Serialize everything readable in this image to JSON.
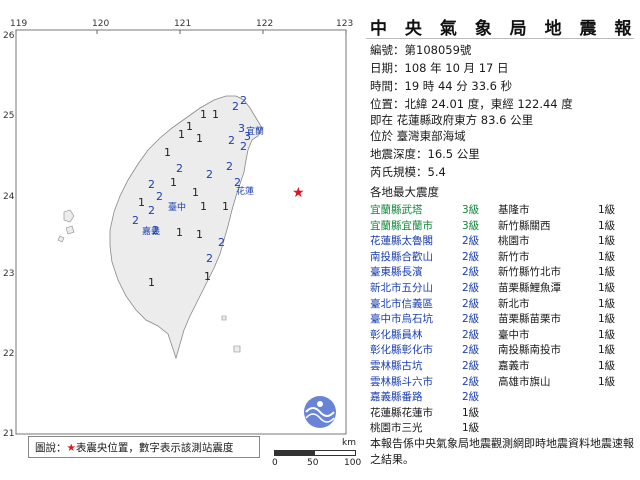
{
  "report": {
    "title": "中 央 氣 象 局 地 震 報 告",
    "number_label": "編號：",
    "number": "第108059號",
    "date_label": "日期：",
    "date": "108 年 10 月 17 日",
    "time_label": "時間：",
    "time": "19 時 44 分 33.6 秒",
    "location_label": "位置：",
    "location": "北緯 24.01 度，東經 122.44 度",
    "location_line2": "即在 花蓮縣政府東方 83.6 公里",
    "location_line3": "位於 臺灣東部海域",
    "depth_label": "地震深度：",
    "depth": "16.5 公里",
    "magnitude_label": "芮氏規模：",
    "magnitude": "5.4",
    "intensity_header": "各地最大震度"
  },
  "intensities_left": [
    {
      "site": "宜蘭縣武塔",
      "level": "3級",
      "color": "green"
    },
    {
      "site": "宜蘭縣宜蘭市",
      "level": "3級",
      "color": "green"
    },
    {
      "site": "花蓮縣太魯閣",
      "level": "2級",
      "color": "blue"
    },
    {
      "site": "南投縣合歡山",
      "level": "2級",
      "color": "blue"
    },
    {
      "site": "臺東縣長濱",
      "level": "2級",
      "color": "blue"
    },
    {
      "site": "新北市五分山",
      "level": "2級",
      "color": "blue"
    },
    {
      "site": "臺北市信義區",
      "level": "2級",
      "color": "blue"
    },
    {
      "site": "臺中市烏石坑",
      "level": "2級",
      "color": "blue"
    },
    {
      "site": "彰化縣員林",
      "level": "2級",
      "color": "blue"
    },
    {
      "site": "彰化縣彰化市",
      "level": "2級",
      "color": "blue"
    },
    {
      "site": "雲林縣古坑",
      "level": "2級",
      "color": "blue"
    },
    {
      "site": "雲林縣斗六市",
      "level": "2級",
      "color": "blue"
    },
    {
      "site": "嘉義縣番路",
      "level": "2級",
      "color": "blue"
    },
    {
      "site": "花蓮縣花蓮市",
      "level": "1級",
      "color": "black"
    },
    {
      "site": "桃園市三光",
      "level": "1級",
      "color": "black"
    }
  ],
  "intensities_right": [
    {
      "site": "基隆市",
      "level": "1級"
    },
    {
      "site": "新竹縣關西",
      "level": "1級"
    },
    {
      "site": "桃園市",
      "level": "1級"
    },
    {
      "site": "新竹市",
      "level": "1級"
    },
    {
      "site": "新竹縣竹北市",
      "level": "1級"
    },
    {
      "site": "苗栗縣鯉魚潭",
      "level": "1級"
    },
    {
      "site": "新北市",
      "level": "1級"
    },
    {
      "site": "苗栗縣苗栗市",
      "level": "1級"
    },
    {
      "site": "臺中市",
      "level": "1級"
    },
    {
      "site": "南投縣南投市",
      "level": "1級"
    },
    {
      "site": "嘉義市",
      "level": "1級"
    },
    {
      "site": "高雄市旗山",
      "level": "1級"
    }
  ],
  "footer": {
    "note": "本報告係中央氣象局地震觀測網即時地震資料地震速報之結果。"
  },
  "legend": {
    "prefix": "圖說：",
    "star": "★",
    "text": "表震央位置，數字表示該測站震度"
  },
  "map": {
    "lon_labels": [
      "119",
      "120",
      "121",
      "122",
      "123"
    ],
    "lat_labels": [
      "26",
      "25",
      "24",
      "23",
      "22",
      "21"
    ],
    "cities": [
      "宜蘭",
      "花蓮",
      "臺中",
      "嘉義"
    ],
    "scale_unit": "km",
    "scale_ticks": [
      "0",
      "50",
      "100"
    ],
    "land_color": "#ececec",
    "sea_color": "#ffffff",
    "epicenter_color": "#e0141e",
    "station_color": "#1a3fb0"
  }
}
